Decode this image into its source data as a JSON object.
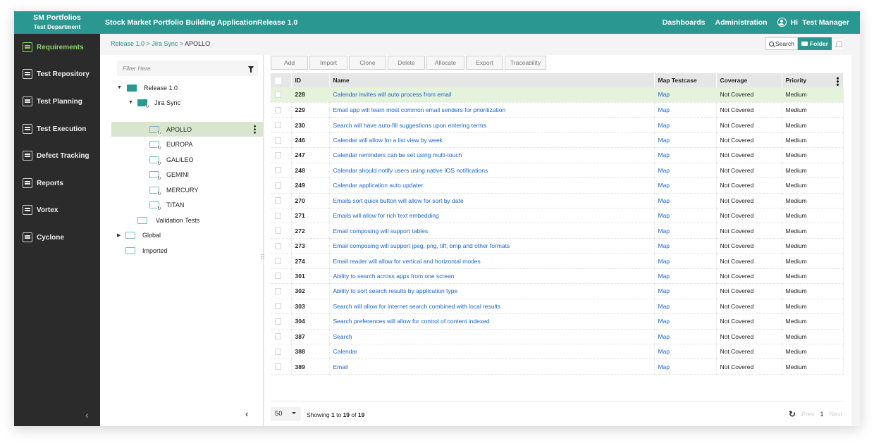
{
  "header": {
    "org": "SM Portfolios",
    "department": "Test Department",
    "app_title": "Stock Market Portfolio Building Application",
    "release": "Release 1.0",
    "nav": [
      "Dashboards",
      "Administration"
    ],
    "greeting": "Hi",
    "user_name": "Test Manager",
    "accent_color": "#2a9890"
  },
  "sidebar": {
    "items": [
      {
        "label": "Requirements",
        "icon": "requirements-icon",
        "active": true
      },
      {
        "label": "Test Repository",
        "icon": "test-repository-icon"
      },
      {
        "label": "Test Planning",
        "icon": "test-planning-icon"
      },
      {
        "label": "Test Execution",
        "icon": "test-execution-icon"
      },
      {
        "label": "Defect Tracking",
        "icon": "bug-icon"
      },
      {
        "label": "Reports",
        "icon": "bar-chart-icon"
      },
      {
        "label": "Vortex",
        "icon": "vortex-icon"
      },
      {
        "label": "Cyclone",
        "icon": "cyclone-icon"
      }
    ],
    "collapse_glyph": "‹"
  },
  "breadcrumb": {
    "items": [
      "Release 1.0",
      "Jira Sync"
    ],
    "separator": ">",
    "current": "APOLLO"
  },
  "view_toggle": {
    "search": "Search",
    "folder": "Folder"
  },
  "tree": {
    "filter_placeholder": "Filter Here",
    "nodes": [
      {
        "label": "Release 1.0",
        "level": 0,
        "expanded": true
      },
      {
        "label": "Jira Sync",
        "level": 1,
        "expanded": true
      },
      {
        "label": "APOLLO",
        "level": 2,
        "selected": true
      },
      {
        "label": "EUROPA",
        "level": 2
      },
      {
        "label": "GALILEO",
        "level": 2
      },
      {
        "label": "GEMINI",
        "level": 2
      },
      {
        "label": "MERCURY",
        "level": 2
      },
      {
        "label": "TITAN",
        "level": 2
      },
      {
        "label": "Validation Tests",
        "level": 1
      },
      {
        "label": "Global",
        "level": 0,
        "expanded": false
      },
      {
        "label": "Imported",
        "level": 0
      }
    ],
    "collapse_glyph": "‹"
  },
  "toolbar": {
    "buttons": [
      "Add",
      "Import",
      "Clone",
      "Delete",
      "Allocate",
      "Export",
      "Traceability"
    ]
  },
  "table": {
    "columns": [
      "ID",
      "Name",
      "Map Testcase",
      "Coverage",
      "Priority"
    ],
    "rows": [
      {
        "id": "228",
        "name": "Calendar invites will auto process from email",
        "map": "Map",
        "coverage": "Not Covered",
        "priority": "Medium"
      },
      {
        "id": "229",
        "name": "Email app will learn most common email senders for prioritization",
        "map": "Map",
        "coverage": "Not Covered",
        "priority": "Medium"
      },
      {
        "id": "230",
        "name": "Search will have auto-fill suggestions upon entering terms",
        "map": "Map",
        "coverage": "Not Covered",
        "priority": "Medium"
      },
      {
        "id": "246",
        "name": "Calendar will allow for a list view by week",
        "map": "Map",
        "coverage": "Not Covered",
        "priority": "Medium"
      },
      {
        "id": "247",
        "name": "Calendar reminders can be set using multi-touch",
        "map": "Map",
        "coverage": "Not Covered",
        "priority": "Medium"
      },
      {
        "id": "248",
        "name": "Calendar should notify users using native IOS notifications",
        "map": "Map",
        "coverage": "Not Covered",
        "priority": "Medium"
      },
      {
        "id": "249",
        "name": "Calendar application auto updater",
        "map": "Map",
        "coverage": "Not Covered",
        "priority": "Medium"
      },
      {
        "id": "270",
        "name": "Emails sort quick button will allow for sort by date",
        "map": "Map",
        "coverage": "Not Covered",
        "priority": "Medium"
      },
      {
        "id": "271",
        "name": "Emails will allow for rich text embedding",
        "map": "Map",
        "coverage": "Not Covered",
        "priority": "Medium"
      },
      {
        "id": "272",
        "name": "Email composing will support tables",
        "map": "Map",
        "coverage": "Not Covered",
        "priority": "Medium"
      },
      {
        "id": "273",
        "name": "Email composing will support jpeg, png, tiff, bmp and other formats",
        "map": "Map",
        "coverage": "Not Covered",
        "priority": "Medium"
      },
      {
        "id": "274",
        "name": "Email reader will allow for vertical and horizontal modes",
        "map": "Map",
        "coverage": "Not Covered",
        "priority": "Medium"
      },
      {
        "id": "301",
        "name": "Ability to search across apps from one screen",
        "map": "Map",
        "coverage": "Not Covered",
        "priority": "Medium"
      },
      {
        "id": "302",
        "name": "Ability to sort search results by application type",
        "map": "Map",
        "coverage": "Not Covered",
        "priority": "Medium"
      },
      {
        "id": "303",
        "name": "Search will allow for internet search combined with local results",
        "map": "Map",
        "coverage": "Not Covered",
        "priority": "Medium"
      },
      {
        "id": "304",
        "name": "Search preferences will allow for control of content indexed",
        "map": "Map",
        "coverage": "Not Covered",
        "priority": "Medium"
      },
      {
        "id": "387",
        "name": "Search",
        "map": "Map",
        "coverage": "Not Covered",
        "priority": "Medium"
      },
      {
        "id": "388",
        "name": "Calendar",
        "map": "Map",
        "coverage": "Not Covered",
        "priority": "Medium"
      },
      {
        "id": "389",
        "name": "Email",
        "map": "Map",
        "coverage": "Not Covered",
        "priority": "Medium"
      }
    ],
    "highlighted_row_index": 0
  },
  "pagination": {
    "page_size": "50",
    "showing_prefix": "Showing",
    "from": "1",
    "to_word": "to",
    "to": "19",
    "of_word": "of",
    "total": "19",
    "prev": "Prev",
    "current_page": "1",
    "next": "Next"
  }
}
